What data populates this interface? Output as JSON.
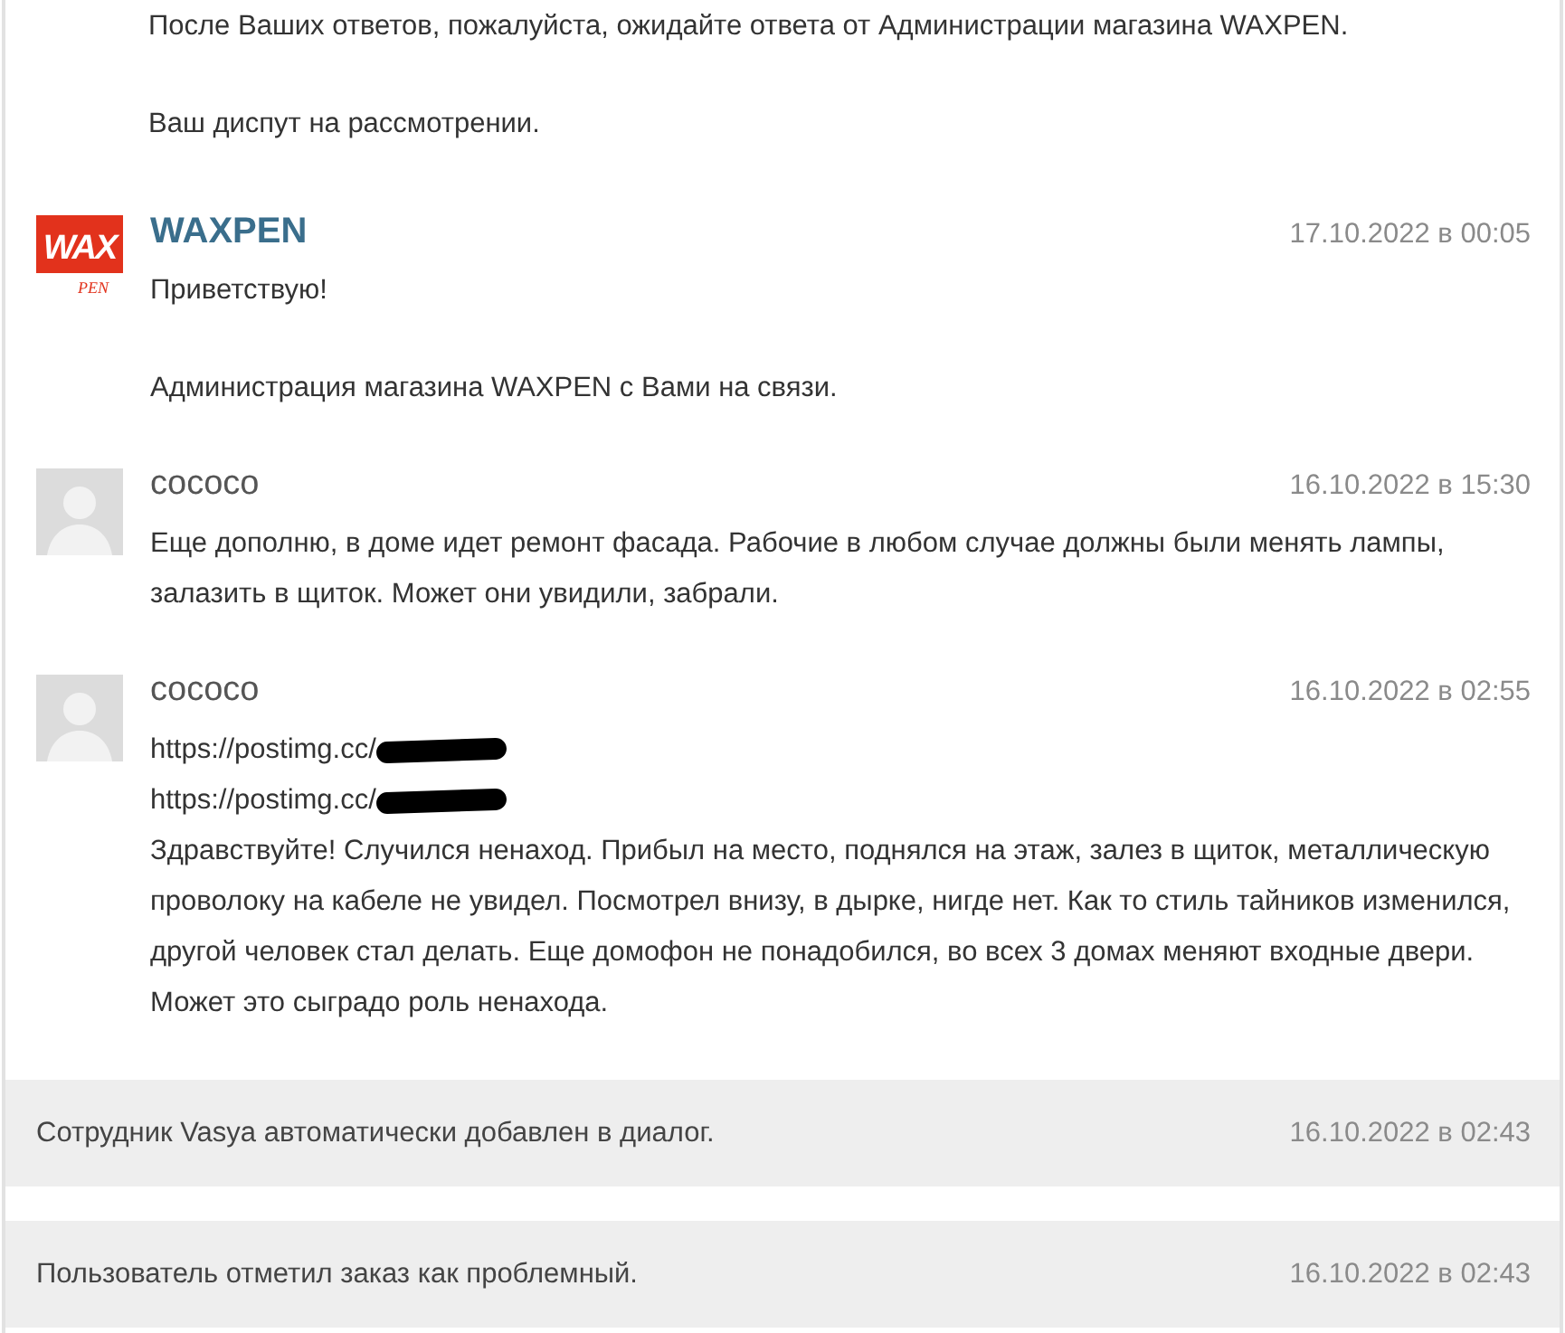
{
  "messages": [
    {
      "kind": "continuation",
      "paragraphs": [
        [
          "После Ваших ответов, пожалуйста, ожидайте ответа от Администрации магазина WAXPEN."
        ],
        [
          "Ваш диспут на рассмотрении."
        ]
      ]
    },
    {
      "kind": "message",
      "author": "WAXPEN",
      "staff": true,
      "avatar": {
        "kind": "logo",
        "top": "WAX",
        "bottom": "PEN"
      },
      "time": "17.10.2022 в 00:05",
      "paragraphs": [
        [
          "Приветствую!"
        ],
        [
          "Администрация магазина WAXPEN с Вами на связи."
        ]
      ]
    },
    {
      "kind": "message",
      "author": "cococo",
      "staff": false,
      "avatar": {
        "kind": "default"
      },
      "time": "16.10.2022 в 15:30",
      "paragraphs": [
        [
          "Еще дополню, в доме идет ремонт фасада. Рабочие в любом случае должны были менять лампы, залазить в щиток. Может они увидили, забрали."
        ]
      ]
    },
    {
      "kind": "message",
      "author": "cococo",
      "staff": false,
      "avatar": {
        "kind": "default"
      },
      "time": "16.10.2022 в 02:55",
      "links": [
        {
          "text": "https://postimg.cc/",
          "redacted": true
        },
        {
          "text": "https://postimg.cc/",
          "redacted": true
        }
      ],
      "paragraphs": [
        [
          "Здравствуйте! Случился ненаход. Прибыл на место, поднялся на этаж, залез в щиток, металлическую проволоку на кабеле не увидел. Посмотрел внизу, в дырке, нигде нет. Как то стиль тайников изменился, другой человек стал делать. Еще домофон не понадобился, во всех 3 домах меняют входные двери. Может это сыградо роль ненахода."
        ]
      ]
    },
    {
      "kind": "event",
      "text": "Сотрудник Vasya автоматически добавлен в диалог.",
      "time": "16.10.2022 в 02:43"
    },
    {
      "kind": "event",
      "text": "Пользователь отметил заказ как проблемный.",
      "time": "16.10.2022 в 02:43"
    }
  ]
}
